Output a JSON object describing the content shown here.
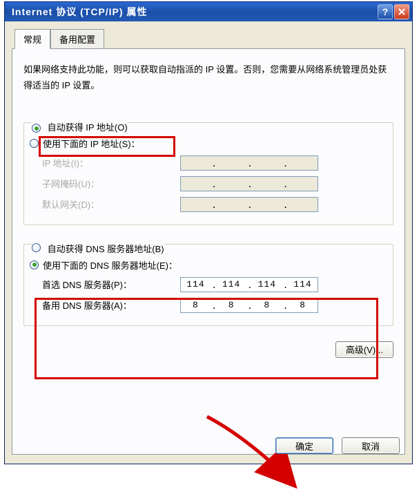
{
  "window": {
    "title": "Internet 协议 (TCP/IP) 属性"
  },
  "tabs": {
    "general": "常规",
    "alternate": "备用配置"
  },
  "intro": "如果网络支持此功能，则可以获取自动指派的 IP 设置。否则，您需要从网络系统管理员处获得适当的 IP 设置。",
  "ip": {
    "auto_label": "自动获得 IP 地址(O)",
    "manual_label": "使用下面的 IP 地址(S)：",
    "ip_address_label": "IP 地址(I)：",
    "subnet_label": "子网掩码(U)：",
    "gateway_label": "默认网关(D)："
  },
  "dns": {
    "auto_label": "自动获得 DNS 服务器地址(B)",
    "manual_label": "使用下面的 DNS 服务器地址(E)：",
    "preferred_label": "首选 DNS 服务器(P)：",
    "alternate_label": "备用 DNS 服务器(A)：",
    "preferred": {
      "o1": "114",
      "o2": "114",
      "o3": "114",
      "o4": "114"
    },
    "alternate": {
      "o1": "8",
      "o2": "8",
      "o3": "8",
      "o4": "8"
    }
  },
  "buttons": {
    "advanced": "高级(V)...",
    "ok": "确定",
    "cancel": "取消"
  }
}
